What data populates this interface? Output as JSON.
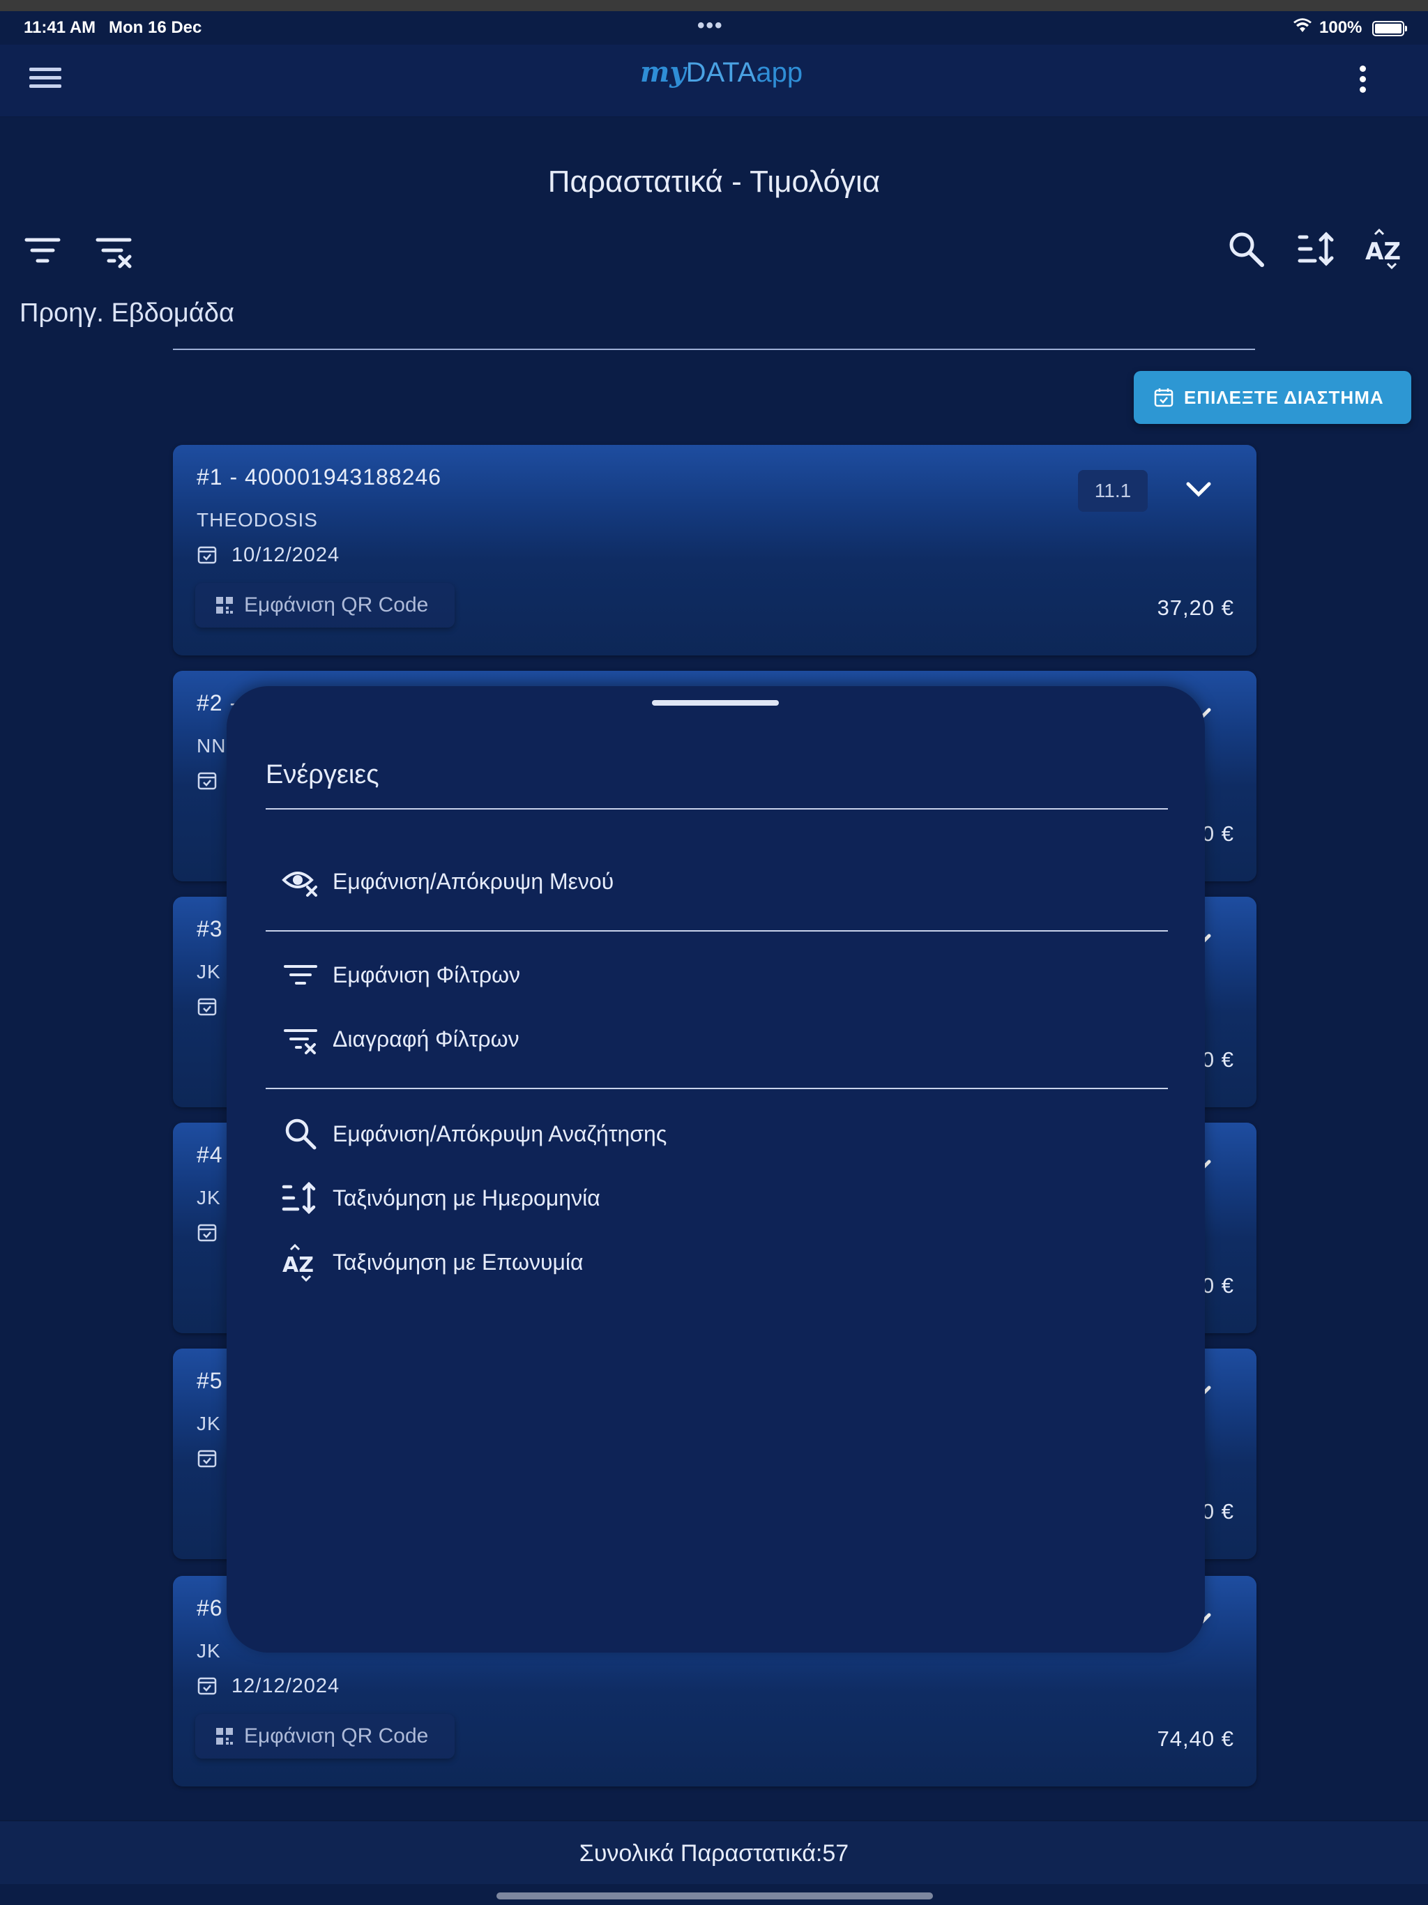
{
  "status": {
    "time": "11:41 AM",
    "date": "Mon 16 Dec",
    "dots": "•••",
    "battery": "100%"
  },
  "app": {
    "logo_my": "my",
    "logo_data": "DATA",
    "logo_app": "app"
  },
  "page": {
    "title": "Παραστατικά - Τιμολόγια",
    "period": "Προηγ. Εβδομάδα",
    "select_period": "ΕΠΙΛΕΞΤΕ ΔΙΑΣΤΗΜΑ"
  },
  "toolbar": {
    "icons": [
      "filter-icon",
      "clear-filter-icon",
      "search-icon",
      "sort-date-icon",
      "sort-az-icon"
    ]
  },
  "cards": [
    {
      "num": "#1 - 400001943188246",
      "name": "THEODOSIS",
      "date": "10/12/2024",
      "qr": "Εμφάνιση QR Code",
      "amount": "37,20 €",
      "badge": "11.1"
    },
    {
      "num": "#2 -",
      "name": "NN",
      "date": "",
      "qr": "",
      "amount": "0 €",
      "badge": ""
    },
    {
      "num": "#3",
      "name": "JK",
      "date": "",
      "qr": "",
      "amount": "0 €",
      "badge": ""
    },
    {
      "num": "#4",
      "name": "JK",
      "date": "",
      "qr": "",
      "amount": "0 €",
      "badge": ""
    },
    {
      "num": "#5",
      "name": "JK",
      "date": "",
      "qr": "",
      "amount": "0 €",
      "badge": ""
    },
    {
      "num": "#6",
      "name": "JK",
      "date": "12/12/2024",
      "qr": "Εμφάνιση QR Code",
      "amount": "74,40 €",
      "badge": ""
    }
  ],
  "sheet": {
    "title": "Ενέργειες",
    "actions": [
      {
        "label": "Εμφάνιση/Απόκρυψη Μενού",
        "icon": "eye-off-icon"
      },
      {
        "label": "Εμφάνιση Φίλτρων",
        "icon": "filter-icon"
      },
      {
        "label": "Διαγραφή Φίλτρων",
        "icon": "clear-filter-icon"
      },
      {
        "label": "Εμφάνιση/Απόκρυψη Αναζήτησης",
        "icon": "search-icon"
      },
      {
        "label": "Ταξινόμηση με Ημερομηνία",
        "icon": "sort-date-icon"
      },
      {
        "label": "Ταξινόμηση με Επωνυμία",
        "icon": "sort-az-icon"
      }
    ]
  },
  "footer": {
    "total": "Συνολικά Παραστατικά:57"
  },
  "colors": {
    "background": "#0b1d46",
    "accent": "#2d97d3",
    "sheet": "#0e2356"
  }
}
